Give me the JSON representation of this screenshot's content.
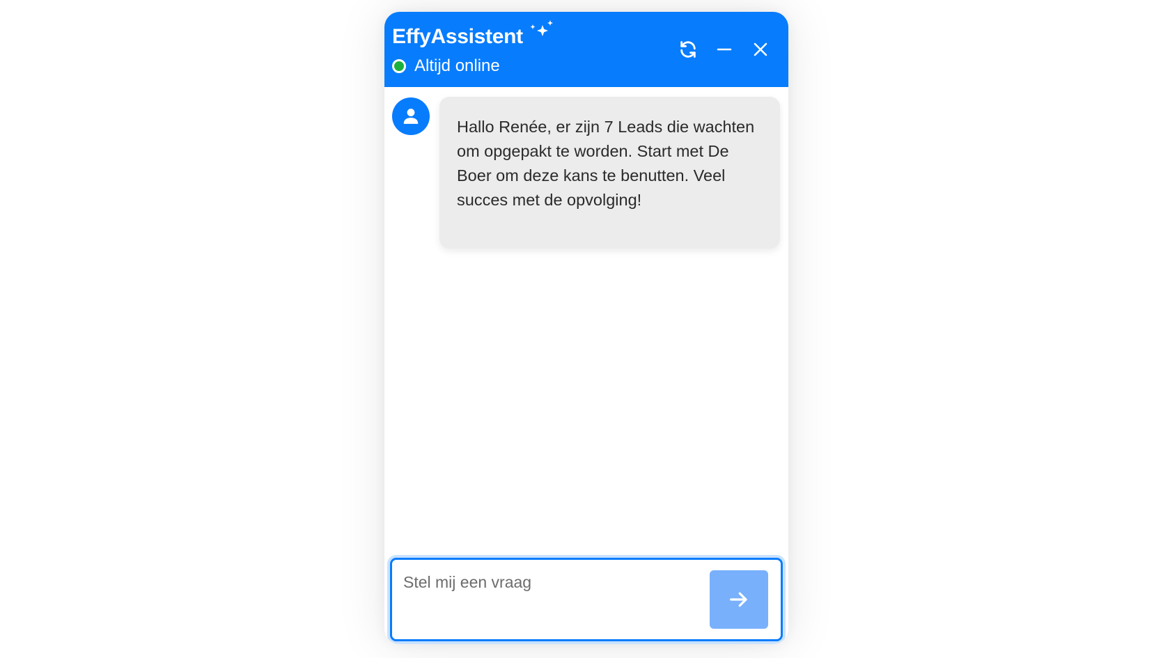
{
  "header": {
    "title": "EffyAssistent",
    "status_text": "Altijd online",
    "status_color": "#1bb13d",
    "background_color": "#077cfd",
    "icons": {
      "sparkles": "sparkles-icon",
      "refresh": "refresh-icon",
      "minimize": "minimize-icon",
      "close": "close-icon"
    }
  },
  "messages": [
    {
      "sender": "assistant",
      "avatar_icon": "user-icon",
      "text": "Hallo Renée, er zijn 7 Leads die wachten om opgepakt te worden. Start met De Boer om deze kans te benutten. Veel succes met de opvolging!"
    }
  ],
  "composer": {
    "placeholder": "Stel mij een vraag",
    "value": "",
    "send_icon": "arrow-right-icon",
    "send_button_color": "#78b0fc"
  }
}
